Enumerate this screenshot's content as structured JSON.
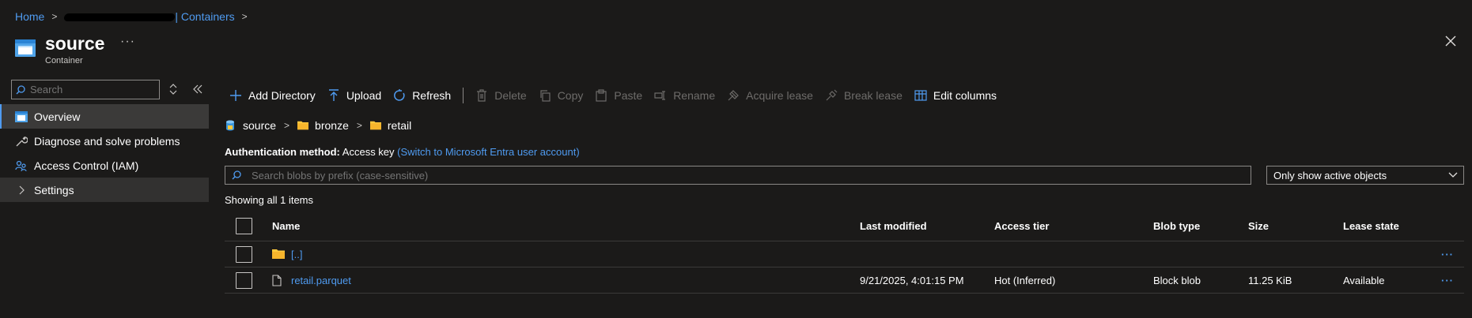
{
  "breadcrumb": {
    "home": "Home",
    "resource": "| Containers"
  },
  "header": {
    "title": "source",
    "more": "···",
    "subtitle": "Container"
  },
  "sidebar": {
    "search_placeholder": "Search",
    "items": [
      {
        "label": "Overview",
        "icon": "container-icon",
        "active": true
      },
      {
        "label": "Diagnose and solve problems",
        "icon": "wrench-icon"
      },
      {
        "label": "Access Control (IAM)",
        "icon": "people-icon"
      },
      {
        "label": "Settings",
        "icon": "chevron-right-icon"
      }
    ]
  },
  "toolbar": {
    "add_directory": "Add Directory",
    "upload": "Upload",
    "refresh": "Refresh",
    "delete": "Delete",
    "copy": "Copy",
    "paste": "Paste",
    "rename": "Rename",
    "acquire_lease": "Acquire lease",
    "break_lease": "Break lease",
    "edit_columns": "Edit columns"
  },
  "path": [
    "source",
    "bronze",
    "retail"
  ],
  "auth": {
    "label": "Authentication method:",
    "value": "Access key",
    "switch_link": "(Switch to Microsoft Entra user account)"
  },
  "blob_search": {
    "placeholder": "Search blobs by prefix (case-sensitive)"
  },
  "filter": {
    "selected": "Only show active objects"
  },
  "count_text": "Showing all 1 items",
  "table": {
    "columns": {
      "name": "Name",
      "last_modified": "Last modified",
      "access_tier": "Access tier",
      "blob_type": "Blob type",
      "size": "Size",
      "lease_state": "Lease state"
    },
    "rows": [
      {
        "name": "[..]",
        "icon": "folder-icon",
        "last_modified": "",
        "access_tier": "",
        "blob_type": "",
        "size": "",
        "lease_state": "",
        "more": "···"
      },
      {
        "name": "retail.parquet",
        "icon": "file-icon",
        "last_modified": "9/21/2025, 4:01:15 PM",
        "access_tier": "Hot (Inferred)",
        "blob_type": "Block blob",
        "size": "11.25 KiB",
        "lease_state": "Available",
        "more": "···"
      }
    ]
  },
  "colors": {
    "background": "#1b1a19",
    "accent": "#4f9bf0",
    "folder": "#ffc83d"
  }
}
